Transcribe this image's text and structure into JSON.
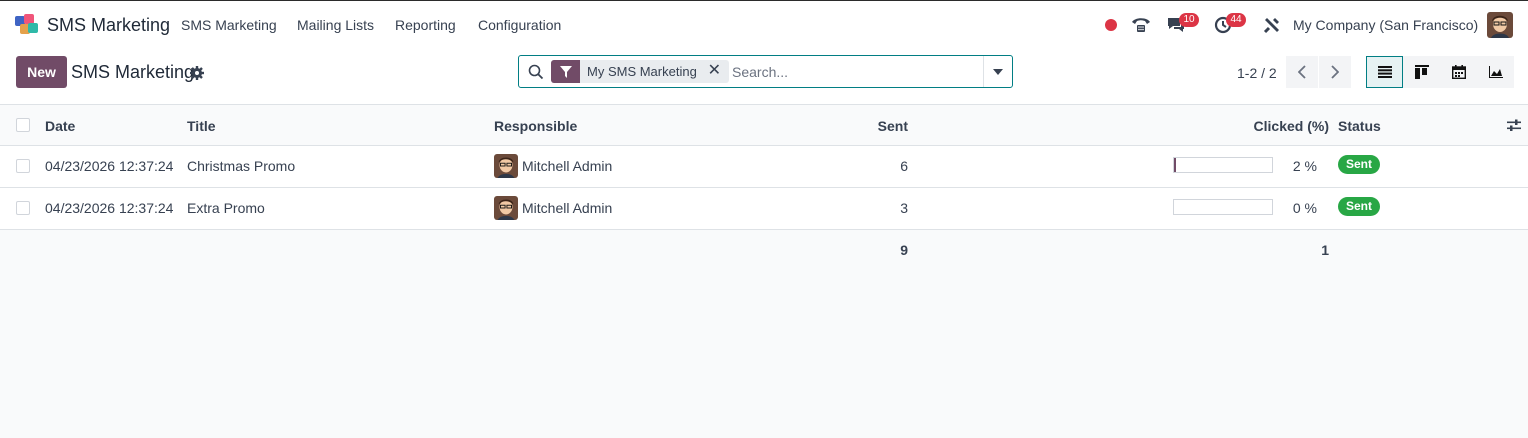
{
  "nav": {
    "app_name": "SMS Marketing",
    "menu": [
      "SMS Marketing",
      "Mailing Lists",
      "Reporting",
      "Configuration"
    ],
    "messages_count": "10",
    "activities_count": "44",
    "company": "My Company (San Francisco)"
  },
  "control": {
    "new_label": "New",
    "breadcrumb": "SMS Marketing",
    "search": {
      "facet": "My SMS Marketing",
      "placeholder": "Search..."
    },
    "pager": "1-2 / 2"
  },
  "list": {
    "columns": [
      "Date",
      "Title",
      "Responsible",
      "Sent",
      "Clicked (%)",
      "Status"
    ],
    "rows": [
      {
        "date": "04/23/2026 12:37:24",
        "title": "Christmas Promo",
        "responsible": "Mitchell Admin",
        "sent": "6",
        "clicked_pct": 2,
        "clicked_label": "2 %",
        "status": "Sent"
      },
      {
        "date": "04/23/2026 12:37:24",
        "title": "Extra Promo",
        "responsible": "Mitchell Admin",
        "sent": "3",
        "clicked_pct": 0,
        "clicked_label": "0 %",
        "status": "Sent"
      }
    ],
    "totals": {
      "sent": "9",
      "clicked": "1"
    }
  },
  "colors": {
    "brand": "#714b67",
    "accent": "#017e84",
    "success": "#28a745",
    "danger": "#dc3545"
  }
}
